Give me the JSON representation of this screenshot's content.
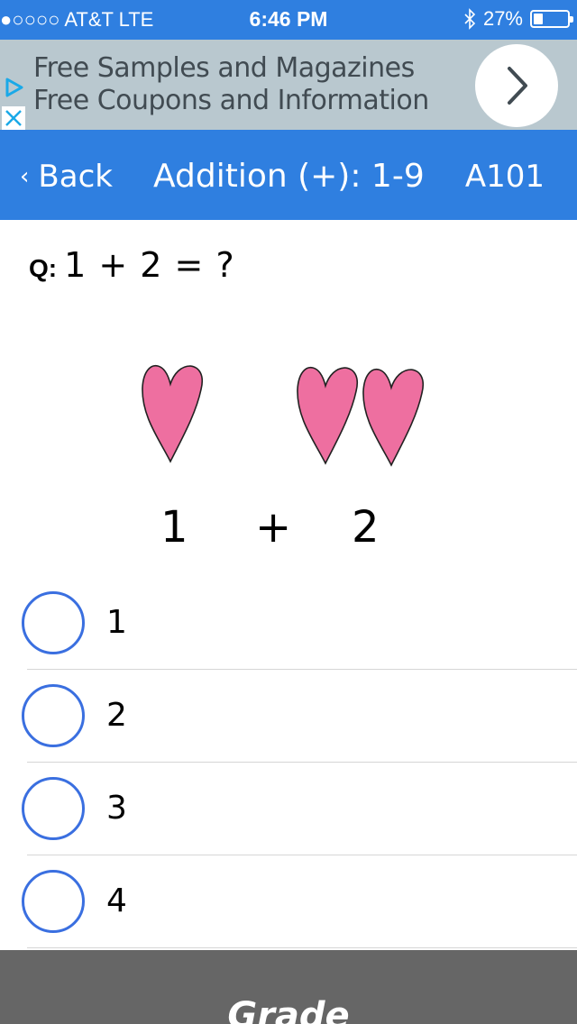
{
  "status_bar": {
    "carrier": "●○○○○ AT&T   LTE",
    "time": "6:46 PM",
    "battery": "27%",
    "battery_level": 0.27,
    "bluetooth_icon": "bluetooth-icon"
  },
  "ad": {
    "text": "Free Samples and Magazines Free Coupons and Information",
    "play_icon": "ad-choices-play-icon",
    "close_icon": "close-icon",
    "arrow_icon": "chevron-right-icon"
  },
  "nav": {
    "back_label": "Back",
    "title": "Addition (+): 1-9",
    "code": "A101"
  },
  "question": {
    "label": "Q:",
    "text": "1 + 2 = ?"
  },
  "illustration": {
    "left_number": "1",
    "operator": "+",
    "right_number": "2",
    "left_hearts": 1,
    "right_hearts": 2,
    "heart_color": "#ee6fa0"
  },
  "options": [
    {
      "label": "1"
    },
    {
      "label": "2"
    },
    {
      "label": "3"
    },
    {
      "label": "4"
    }
  ],
  "grade": {
    "label": "Grade"
  },
  "colors": {
    "accent": "#2f7fe0",
    "radio": "#3a6fe0",
    "grade_bar": "#666666"
  }
}
